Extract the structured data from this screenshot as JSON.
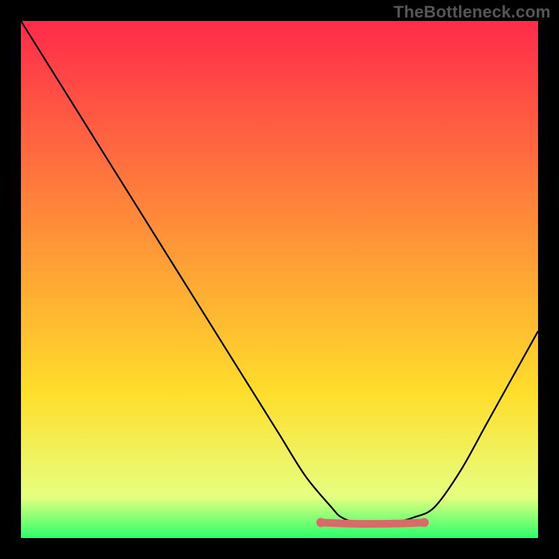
{
  "watermark": "TheBottleneck.com",
  "chart_data": {
    "type": "line",
    "title": "",
    "xlabel": "",
    "ylabel": "",
    "xlim": [
      0,
      100
    ],
    "ylim": [
      0,
      100
    ],
    "grid": false,
    "legend": "none",
    "background_gradient": {
      "top_color": "#ff2b4a",
      "mid_color": "#ffde2b",
      "bottom_color": "#2bff6a"
    },
    "series": [
      {
        "name": "curve",
        "color": "#000000",
        "x": [
          0,
          5,
          10,
          15,
          20,
          25,
          30,
          35,
          40,
          45,
          50,
          55,
          60,
          62,
          65,
          68,
          72,
          76,
          80,
          85,
          90,
          95,
          100
        ],
        "y": [
          100,
          92,
          84,
          76,
          68,
          60,
          52,
          44,
          36,
          28,
          20,
          12,
          6,
          4,
          3,
          3,
          3,
          4,
          6,
          13,
          22,
          31,
          40
        ]
      }
    ],
    "highlight": {
      "name": "bottleneck-range",
      "color": "#d86a6a",
      "x": [
        58,
        78
      ],
      "y": [
        3,
        3
      ]
    }
  }
}
